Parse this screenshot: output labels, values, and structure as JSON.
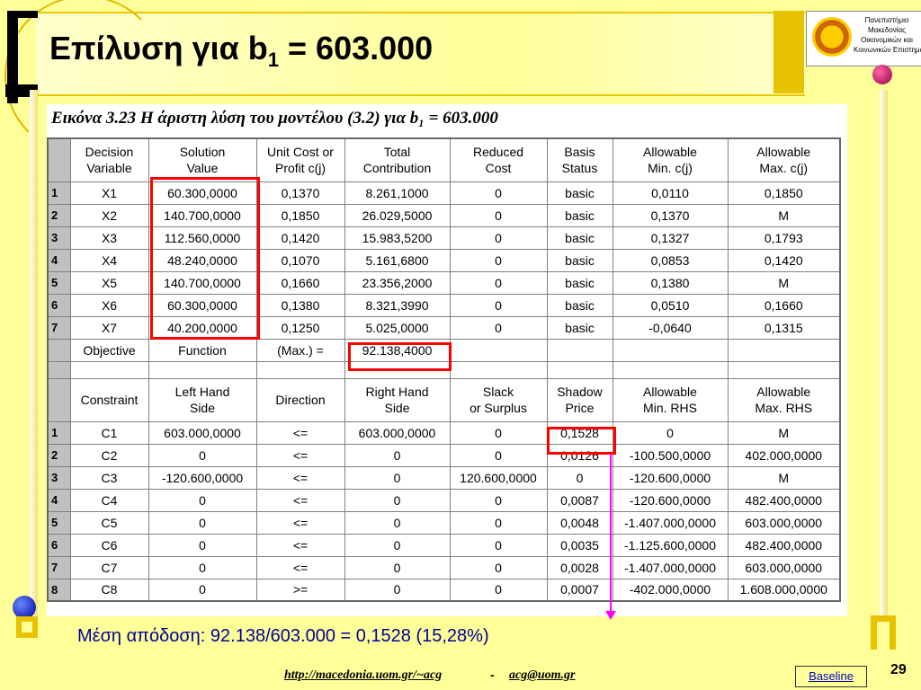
{
  "slide": {
    "title_prefix": "Επίλυση για b",
    "title_sub": "1",
    "title_suffix": " = 603.000"
  },
  "logo": {
    "lines": [
      "Πανεπιστήμιο",
      "Μακεδονίας",
      "Οικονομικών και",
      "Κοινωνικών Επιστημών"
    ]
  },
  "figure": {
    "caption": "Εικόνα 3.23 Η άριστη λύση του μοντέλου (3.2) για  b₁ = 603.000",
    "headers1": [
      [
        "Decision",
        "Variable"
      ],
      [
        "Solution",
        "Value"
      ],
      [
        "Unit Cost or",
        "Profit c(j)"
      ],
      [
        "Total",
        "Contribution"
      ],
      [
        "Reduced",
        "Cost"
      ],
      [
        "Basis",
        "Status"
      ],
      [
        "Allowable",
        "Min. c(j)"
      ],
      [
        "Allowable",
        "Max. c(j)"
      ]
    ],
    "rows1": [
      [
        "1",
        "X1",
        "60.300,0000",
        "0,1370",
        "8.261,1000",
        "0",
        "basic",
        "0,0110",
        "0,1850"
      ],
      [
        "2",
        "X2",
        "140.700,0000",
        "0,1850",
        "26.029,5000",
        "0",
        "basic",
        "0,1370",
        "M"
      ],
      [
        "3",
        "X3",
        "112.560,0000",
        "0,1420",
        "15.983,5200",
        "0",
        "basic",
        "0,1327",
        "0,1793"
      ],
      [
        "4",
        "X4",
        "48.240,0000",
        "0,1070",
        "5.161,6800",
        "0",
        "basic",
        "0,0853",
        "0,1420"
      ],
      [
        "5",
        "X5",
        "140.700,0000",
        "0,1660",
        "23.356,2000",
        "0",
        "basic",
        "0,1380",
        "M"
      ],
      [
        "6",
        "X6",
        "60.300,0000",
        "0,1380",
        "8.321,3990",
        "0",
        "basic",
        "0,0510",
        "0,1660"
      ],
      [
        "7",
        "X7",
        "40.200,0000",
        "0,1250",
        "5.025,0000",
        "0",
        "basic",
        "-0,0640",
        "0,1315"
      ]
    ],
    "objective": [
      "Objective",
      "Function",
      "(Max.) =",
      "92.138,4000"
    ],
    "headers2": [
      [
        "",
        "Constraint"
      ],
      [
        "Left Hand",
        "Side"
      ],
      [
        "",
        "Direction"
      ],
      [
        "Right Hand",
        "Side"
      ],
      [
        "Slack",
        "or Surplus"
      ],
      [
        "Shadow",
        "Price"
      ],
      [
        "Allowable",
        "Min. RHS"
      ],
      [
        "Allowable",
        "Max. RHS"
      ]
    ],
    "rows2": [
      [
        "1",
        "C1",
        "603.000,0000",
        "<=",
        "603.000,0000",
        "0",
        "0,1528",
        "0",
        "M"
      ],
      [
        "2",
        "C2",
        "0",
        "<=",
        "0",
        "0",
        "0,0126",
        "-100.500,0000",
        "402.000,0000"
      ],
      [
        "3",
        "C3",
        "-120.600,0000",
        "<=",
        "0",
        "120.600,0000",
        "0",
        "-120.600,0000",
        "M"
      ],
      [
        "4",
        "C4",
        "0",
        "<=",
        "0",
        "0",
        "0,0087",
        "-120.600,0000",
        "482.400,0000"
      ],
      [
        "5",
        "C5",
        "0",
        "<=",
        "0",
        "0",
        "0,0048",
        "-1.407.000,0000",
        "603.000,0000"
      ],
      [
        "6",
        "C6",
        "0",
        "<=",
        "0",
        "0",
        "0,0035",
        "-1.125.600,0000",
        "482.400,0000"
      ],
      [
        "7",
        "C7",
        "0",
        "<=",
        "0",
        "0",
        "0,0028",
        "-1.407.000,0000",
        "603.000,0000"
      ],
      [
        "8",
        "C8",
        "0",
        ">=",
        "0",
        "0",
        "0,0007",
        "-402.000,0000",
        "1.608.000,0000"
      ]
    ]
  },
  "summary": "Μέση απόδοση: 92.138/603.000 = 0,1528 (15,28%)",
  "footer": {
    "link": "http://macedonia.uom.gr/~acg",
    "dash": "-",
    "email": "acg@uom.gr",
    "baseline": "Baseline",
    "page": "29"
  },
  "colors": {
    "background": "#ffff99",
    "highlight": "#ff0000",
    "arrow": "#ff00ff",
    "summary_text": "#000099"
  }
}
